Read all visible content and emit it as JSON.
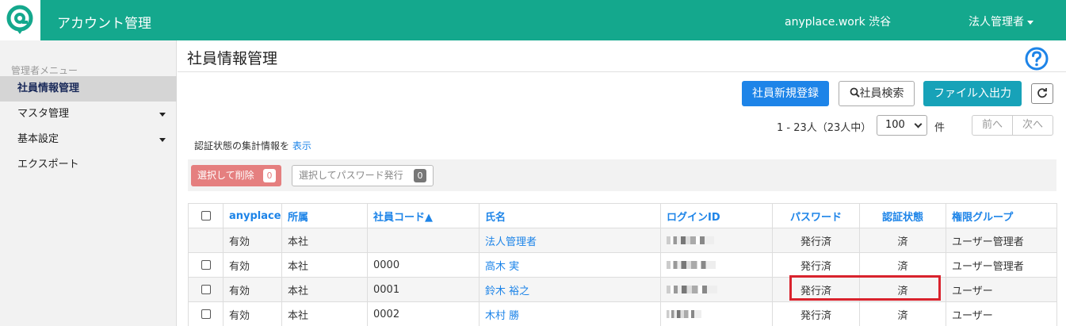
{
  "header": {
    "title": "アカウント管理",
    "location": "anyplace.work 渋谷",
    "user_menu": "法人管理者",
    "brand_color": "#14a88d"
  },
  "sidebar": {
    "heading": "管理者メニュー",
    "items": [
      {
        "label": "社員情報管理",
        "active": true
      },
      {
        "label": "マスタ管理",
        "has_submenu": true
      },
      {
        "label": "基本設定",
        "has_submenu": true
      },
      {
        "label": "エクスポート"
      }
    ]
  },
  "main": {
    "page_title": "社員情報管理",
    "buttons": {
      "new_employee": "社員新規登録",
      "search": "社員検索",
      "file_io": "ファイル入出力"
    },
    "pagination": {
      "range": "1 - 23人（23人中）",
      "per_page": "100",
      "unit": "件",
      "prev": "前へ",
      "next": "次へ"
    },
    "auth_summary": {
      "text": "認証状態の集計情報を",
      "link": "表示"
    },
    "bulk_actions": {
      "delete_label": "選択して削除",
      "delete_count": "0",
      "password_label": "選択してパスワード発行",
      "password_count": "0"
    }
  },
  "table": {
    "headers": [
      "anyplace",
      "所属",
      "社員コード▲",
      "氏名",
      "ログインID",
      "パスワード",
      "認証状態",
      "権限グループ"
    ],
    "rows": [
      {
        "anyplace": "有効",
        "dept": "本社",
        "code": "",
        "name": "法人管理者",
        "password": "発行済",
        "auth": "済",
        "group": "ユーザー管理者",
        "checkbox": false
      },
      {
        "anyplace": "有効",
        "dept": "本社",
        "code": "0000",
        "name": "高木 実",
        "password": "発行済",
        "auth": "済",
        "group": "ユーザー管理者",
        "checkbox": true
      },
      {
        "anyplace": "有効",
        "dept": "本社",
        "code": "0001",
        "name": "鈴木 裕之",
        "password": "発行済",
        "auth": "済",
        "group": "ユーザー",
        "checkbox": true
      },
      {
        "anyplace": "有効",
        "dept": "本社",
        "code": "0002",
        "name": "木村 勝",
        "password": "発行済",
        "auth": "済",
        "group": "ユーザー",
        "checkbox": true
      }
    ]
  }
}
